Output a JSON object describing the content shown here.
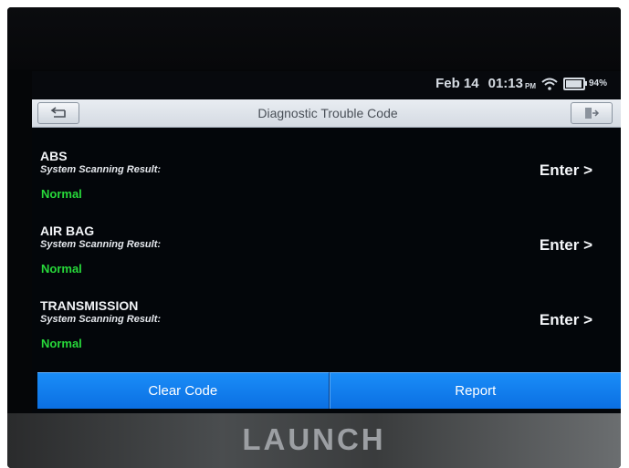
{
  "status_bar": {
    "date": "Feb 14",
    "time": "01:13",
    "ampm": "PM",
    "battery_percent": "94%",
    "battery_level": 0.94
  },
  "titlebar": {
    "title": "Diagnostic Trouble Code",
    "back_icon": "back-arrow-icon",
    "exit_icon": "exit-icon"
  },
  "systems": [
    {
      "name": "ABS",
      "label": "System Scanning Result:",
      "status": "Normal",
      "action": "Enter >"
    },
    {
      "name": "AIR BAG",
      "label": "System Scanning Result:",
      "status": "Normal",
      "action": "Enter >"
    },
    {
      "name": "TRANSMISSION",
      "label": "System Scanning Result:",
      "status": "Normal",
      "action": "Enter >"
    }
  ],
  "buttons": {
    "clear": "Clear Code",
    "report": "Report"
  },
  "device": {
    "brand": "LAUNCH"
  },
  "colors": {
    "accent": "#1a8df8",
    "status_normal": "#27d83a",
    "screen_bg": "#03060a"
  }
}
